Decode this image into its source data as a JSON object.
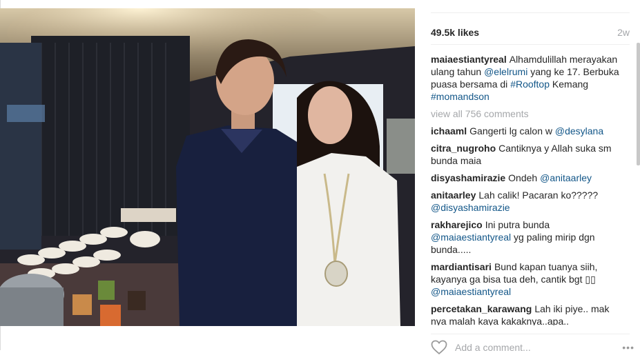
{
  "post": {
    "likes": "49.5k likes",
    "age": "2w",
    "caption": {
      "user": "maiaestiantyreal",
      "parts": [
        {
          "t": "text",
          "v": "Alhamdulillah merayakan ulang tahun "
        },
        {
          "t": "mention",
          "v": "@elelrumi"
        },
        {
          "t": "text",
          "v": " yang ke 17. Berbuka puasa bersama di "
        },
        {
          "t": "mention",
          "v": "#Rooftop"
        },
        {
          "t": "text",
          "v": " Kemang "
        },
        {
          "t": "mention",
          "v": "#momandson"
        }
      ]
    },
    "view_all": "view all 756 comments",
    "comments": [
      {
        "user": "ichaaml",
        "parts": [
          {
            "t": "text",
            "v": "Gangerti lg calon w "
          },
          {
            "t": "mention",
            "v": "@desylana"
          }
        ]
      },
      {
        "user": "citra_nugroho",
        "parts": [
          {
            "t": "text",
            "v": "Cantiknya y Allah suka sm bunda maia"
          }
        ]
      },
      {
        "user": "disyashamirazie",
        "parts": [
          {
            "t": "text",
            "v": "Ondeh "
          },
          {
            "t": "mention",
            "v": "@anitaarley"
          }
        ]
      },
      {
        "user": "anitaarley",
        "parts": [
          {
            "t": "text",
            "v": "Lah calik! Pacaran ko????? "
          },
          {
            "t": "mention",
            "v": "@disyashamirazie"
          }
        ]
      },
      {
        "user": "rakharejico",
        "parts": [
          {
            "t": "text",
            "v": "Ini putra bunda "
          },
          {
            "t": "mention",
            "v": "@maiaestiantyreal"
          },
          {
            "t": "text",
            "v": " yg paling mirip dgn bunda....."
          }
        ]
      },
      {
        "user": "mardiantisari",
        "parts": [
          {
            "t": "text",
            "v": "Bund kapan tuanya siih, kayanya ga bisa tua deh, cantik bgt ▯▯ "
          },
          {
            "t": "mention",
            "v": "@maiaestiantyreal"
          }
        ]
      },
      {
        "user": "percetakan_karawang",
        "parts": [
          {
            "t": "text",
            "v": "Lah iki piye.. mak nya malah kaya kakaknya..apa.."
          }
        ]
      }
    ],
    "add_comment_placeholder": "Add a comment...",
    "more_glyph": "•••"
  },
  "colors": {
    "link": "#125688",
    "muted": "#a5a7aa",
    "text": "#262626"
  }
}
